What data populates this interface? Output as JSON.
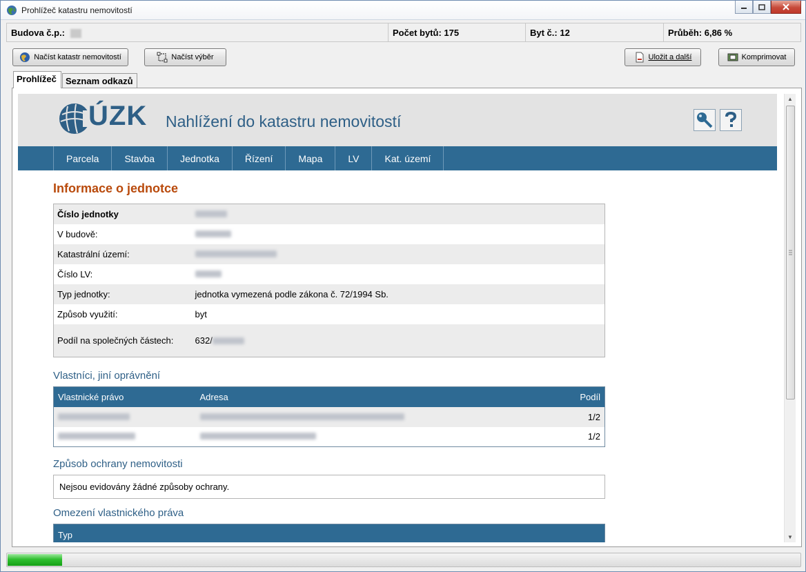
{
  "window": {
    "title": "Prohlížeč katastru nemovitostí"
  },
  "infobar": {
    "budova_label": "Budova č.p.:",
    "pocet_bytu": "Počet bytů: 175",
    "byt_c": "Byt č.: 12",
    "prubeh": "Průběh: 6,86 %"
  },
  "toolbar": {
    "nacist_katastr": "Načíst katastr nemovitostí",
    "nacist_vyber": "Načíst výběr",
    "ulozit_a_dalsi": "Uložit a další",
    "komprimovat": "Komprimovat"
  },
  "tabs": [
    {
      "label": "Prohlížeč",
      "active": true
    },
    {
      "label": "Seznam odkazů",
      "active": false
    }
  ],
  "web": {
    "logo_text": "ÚZK",
    "site_title": "Nahlížení do katastru nemovitostí",
    "nav": [
      "Parcela",
      "Stavba",
      "Jednotka",
      "Řízení",
      "Mapa",
      "LV",
      "Kat. území"
    ],
    "heading": "Informace o jednotce",
    "info_rows": [
      {
        "label": "Číslo jednotky",
        "value": ""
      },
      {
        "label": "V budově:",
        "value": ""
      },
      {
        "label": "Katastrální území:",
        "value": ""
      },
      {
        "label": "Číslo LV:",
        "value": ""
      },
      {
        "label": "Typ jednotky:",
        "value": "jednotka vymezená podle zákona č. 72/1994 Sb."
      },
      {
        "label": "Způsob využití:",
        "value": "byt"
      },
      {
        "label": "Podíl na společných částech:",
        "value": "632/"
      }
    ],
    "owners_heading": "Vlastníci, jiní oprávnění",
    "owners_columns": [
      "Vlastnické právo",
      "Adresa",
      "Podíl"
    ],
    "owners": [
      {
        "podil": "1/2"
      },
      {
        "podil": "1/2"
      }
    ],
    "ochrana_heading": "Způsob ochrany nemovitosti",
    "ochrana_text": "Nejsou evidovány žádné způsoby ochrany.",
    "omezeni_heading": "Omezení vlastnického práva",
    "omezeni_column": "Typ"
  },
  "progress": {
    "value": 0.0686
  },
  "colors": {
    "accent_blue": "#2e6a93",
    "heading_orange": "#b94a0c",
    "progress_green": "#2fbf2f"
  }
}
